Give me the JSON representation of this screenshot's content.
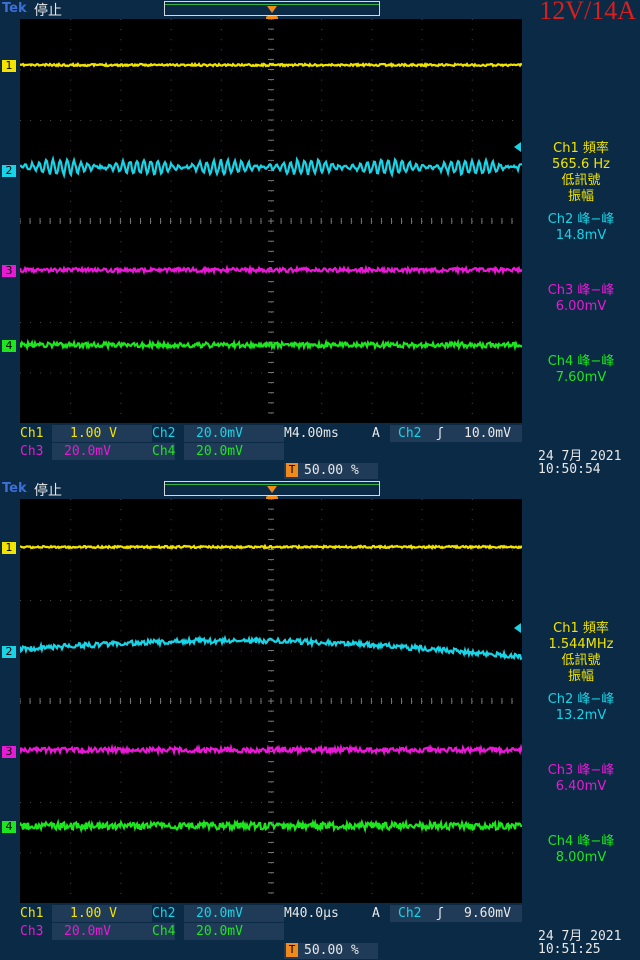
{
  "top": {
    "brand": "Tek",
    "run_state": "停止",
    "badge": "12V/14A",
    "trigger_marker": "T",
    "channel_markers": [
      "1",
      "2",
      "3",
      "4"
    ],
    "measure": {
      "ch1_title": "Ch1 頻率",
      "ch1_value": "565.6 Hz",
      "ch1_note1": "低訊號",
      "ch1_note2": "振幅",
      "ch2_title": "Ch2 峰−峰",
      "ch2_value": "14.8mV",
      "ch3_title": "Ch3 峰−峰",
      "ch3_value": "6.00mV",
      "ch4_title": "Ch4 峰−峰",
      "ch4_value": "7.60mV"
    },
    "status": {
      "ch1_label": "Ch1",
      "ch1_scale": "1.00 V",
      "ch2_label": "Ch2",
      "ch2_scale": "20.0mV",
      "timebase": "M4.00ms",
      "trig_mode": "A",
      "trig_source": "Ch2",
      "trig_level": "10.0mV",
      "ch3_label": "Ch3",
      "ch3_scale": "20.0mV",
      "ch4_label": "Ch4",
      "ch4_scale": "20.0mV",
      "trig_pos": "50.00 %",
      "date": "24 7月  2021",
      "time": "10:50:54"
    }
  },
  "bottom": {
    "brand": "Tek",
    "run_state": "停止",
    "trigger_marker": "T",
    "channel_markers": [
      "1",
      "2",
      "3",
      "4"
    ],
    "measure": {
      "ch1_title": "Ch1 頻率",
      "ch1_value": "1.544MHz",
      "ch1_note1": "低訊號",
      "ch1_note2": "振幅",
      "ch2_title": "Ch2 峰−峰",
      "ch2_value": "13.2mV",
      "ch3_title": "Ch3 峰−峰",
      "ch3_value": "6.40mV",
      "ch4_title": "Ch4 峰−峰",
      "ch4_value": "8.00mV"
    },
    "status": {
      "ch1_label": "Ch1",
      "ch1_scale": "1.00 V",
      "ch2_label": "Ch2",
      "ch2_scale": "20.0mV",
      "timebase": "M40.0µs",
      "trig_mode": "A",
      "trig_source": "Ch2",
      "trig_level": "9.60mV",
      "ch3_label": "Ch3",
      "ch3_scale": "20.0mV",
      "ch4_label": "Ch4",
      "ch4_scale": "20.0mV",
      "trig_pos": "50.00 %",
      "date": "24 7月  2021",
      "time": "10:51:25"
    }
  },
  "colors": {
    "ch1": "#f2e400",
    "ch2": "#19d3e6",
    "ch3": "#e81ad6",
    "ch4": "#1ee61e",
    "trigger": "#f08a1a"
  }
}
